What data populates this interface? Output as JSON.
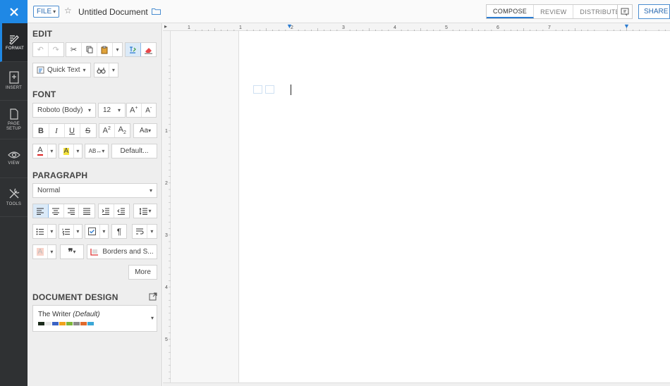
{
  "topbar": {
    "file_label": "FILE",
    "doc_title": "Untitled Document",
    "tabs": [
      "COMPOSE",
      "REVIEW",
      "DISTRIBUTE"
    ],
    "active_tab": "COMPOSE",
    "share_label": "SHARE"
  },
  "nav": {
    "items": [
      {
        "label": "FORMAT",
        "icon": "format-icon",
        "active": true
      },
      {
        "label": "INSERT",
        "icon": "insert-icon"
      },
      {
        "label": "PAGE SETUP",
        "icon": "page-setup-icon"
      },
      {
        "label": "VIEW",
        "icon": "eye-icon"
      },
      {
        "label": "TOOLS",
        "icon": "tools-icon"
      }
    ]
  },
  "panel": {
    "edit_title": "EDIT",
    "quick_text": "Quick Text",
    "font_title": "FONT",
    "font_family": "Roboto (Body)",
    "font_size": "12",
    "default_label": "Default...",
    "paragraph_title": "PARAGRAPH",
    "paragraph_style": "Normal",
    "borders_label": "Borders and S...",
    "more_label": "More",
    "design_title": "DOCUMENT DESIGN",
    "design_name": "The Writer",
    "design_default": "(Default)",
    "swatch_colors": [
      "#1b2a1b",
      "#e8e8e8",
      "#3a63c4",
      "#f0a21c",
      "#7bb53a",
      "#8a8a8a",
      "#e06a2c",
      "#3aa7d6"
    ]
  },
  "ruler": {
    "h_numbers": [
      "1",
      "1",
      "2",
      "3",
      "4",
      "5",
      "6",
      "7"
    ],
    "v_numbers": [
      "1",
      "2",
      "3",
      "4",
      "5"
    ]
  },
  "colors": {
    "accent": "#1f88e5",
    "nav_bg": "#2f3133"
  }
}
